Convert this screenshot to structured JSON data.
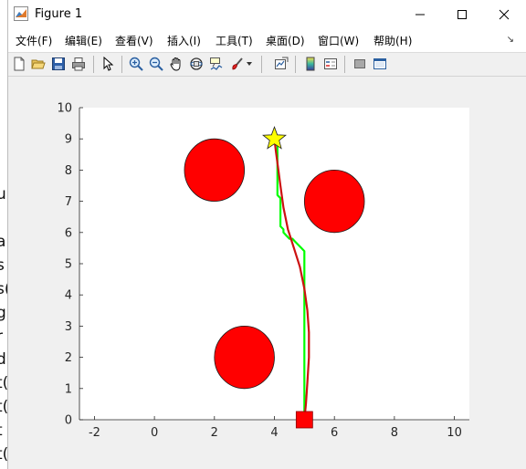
{
  "window": {
    "title": "Figure 1",
    "controls": [
      "minimize",
      "maximize",
      "close"
    ]
  },
  "menubar": {
    "items": [
      {
        "label": "文件(F)"
      },
      {
        "label": "编辑(E)"
      },
      {
        "label": "查看(V)"
      },
      {
        "label": "插入(I)"
      },
      {
        "label": "工具(T)"
      },
      {
        "label": "桌面(D)"
      },
      {
        "label": "窗口(W)"
      },
      {
        "label": "帮助(H)"
      }
    ],
    "dock_arrow": "↘"
  },
  "toolbar": {
    "tools": [
      "new-figure-icon",
      "open-icon",
      "save-icon",
      "print-icon",
      "select-arrow-icon",
      "zoom-in-icon",
      "zoom-out-icon",
      "pan-hand-icon",
      "rotate-3d-icon",
      "data-cursor-icon",
      "brush-icon",
      "brush-dropdown-icon",
      "link-plot-icon",
      "colorbar-icon",
      "legend-icon",
      "hide-plot-tools-icon",
      "show-plot-tools-icon"
    ]
  },
  "background_window": {
    "partial_text": [
      "u",
      "a",
      "s",
      "s(",
      "gi",
      "r",
      "d",
      "t(",
      "t(",
      "t",
      "t("
    ]
  },
  "chart_data": {
    "type": "line",
    "title": "",
    "xlabel": "",
    "ylabel": "",
    "xlim": [
      -2.5,
      10.5
    ],
    "ylim": [
      0,
      10
    ],
    "xticks": [
      -2,
      0,
      2,
      4,
      6,
      8,
      10
    ],
    "yticks": [
      0,
      1,
      2,
      3,
      4,
      5,
      6,
      7,
      8,
      9,
      10
    ],
    "grid": false,
    "obstacles": [
      {
        "shape": "circle",
        "center": [
          2,
          8
        ],
        "radius": 1,
        "color": "#ff0000"
      },
      {
        "shape": "circle",
        "center": [
          6,
          7
        ],
        "radius": 1,
        "color": "#ff0000"
      },
      {
        "shape": "circle",
        "center": [
          3,
          2
        ],
        "radius": 1,
        "color": "#ff0000"
      }
    ],
    "start": {
      "marker": "square",
      "point": [
        5,
        0
      ],
      "color": "#ff0000"
    },
    "goal": {
      "marker": "star",
      "point": [
        4,
        9
      ],
      "color": "#ffff00"
    },
    "series": [
      {
        "color": "#00ff00",
        "x": [
          5,
          5,
          5,
          5,
          5,
          5,
          5,
          5,
          5,
          5,
          5,
          5,
          5,
          5,
          5,
          5,
          5,
          5,
          5,
          5,
          5,
          5,
          5,
          5,
          5,
          5,
          5,
          5,
          5,
          4.9,
          4.8,
          4.7,
          4.6,
          4.5,
          4.4,
          4.3,
          4.3,
          4.2,
          4.2,
          4.2,
          4.2,
          4.2,
          4.2,
          4.2,
          4.2,
          4.2,
          4.2,
          4.1,
          4.1,
          4.1,
          4.1,
          4.1,
          4.1,
          4.1,
          4.1,
          4.1,
          4.1,
          4.1,
          4.1,
          4.1,
          4.1,
          4.1,
          4.1,
          4.1,
          4.0,
          4.0
        ],
        "y": [
          0,
          0.2,
          0.4,
          0.6,
          0.8,
          1.0,
          1.2,
          1.4,
          1.6,
          1.8,
          2.0,
          2.2,
          2.4,
          2.6,
          2.8,
          3.0,
          3.2,
          3.4,
          3.6,
          3.8,
          4.0,
          4.2,
          4.4,
          4.6,
          4.8,
          5.0,
          5.2,
          5.3,
          5.4,
          5.5,
          5.6,
          5.7,
          5.8,
          5.8,
          5.9,
          6.0,
          6.1,
          6.2,
          6.3,
          6.4,
          6.5,
          6.6,
          6.7,
          6.8,
          6.9,
          7.0,
          7.1,
          7.2,
          7.3,
          7.4,
          7.5,
          7.6,
          7.7,
          7.8,
          7.9,
          8.0,
          8.1,
          8.2,
          8.3,
          8.4,
          8.5,
          8.6,
          8.7,
          8.8,
          8.9,
          9.0
        ]
      },
      {
        "color": "#cc1111",
        "x": [
          5.0,
          5.05,
          5.1,
          5.15,
          5.15,
          5.1,
          5.0,
          4.85,
          4.65,
          4.45,
          4.3,
          4.2,
          4.12,
          4.05,
          4.0
        ],
        "y": [
          0,
          0.5,
          1.2,
          2.0,
          2.8,
          3.5,
          4.2,
          4.9,
          5.5,
          6.1,
          6.8,
          7.5,
          8.1,
          8.6,
          9.0
        ]
      }
    ]
  }
}
